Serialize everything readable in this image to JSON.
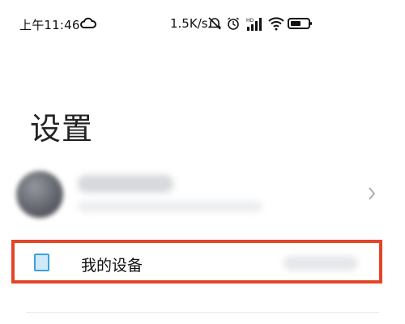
{
  "status_bar": {
    "time": "上午11:46",
    "network_speed": "1.5K/s",
    "icons": [
      "cloud-icon",
      "mute-icon",
      "alarm-icon",
      "signal-icon",
      "wifi-icon",
      "battery-icon"
    ]
  },
  "page": {
    "title": "设置"
  },
  "account": {
    "avatar": "avatar",
    "chevron": "chevron-right-icon"
  },
  "menu": {
    "my_device": {
      "label": "我的设备",
      "icon": "device-icon"
    }
  },
  "colors": {
    "highlight_border": "#e44528",
    "device_icon_border": "#3ba2d9",
    "device_icon_fill": "#cfe9f8"
  }
}
